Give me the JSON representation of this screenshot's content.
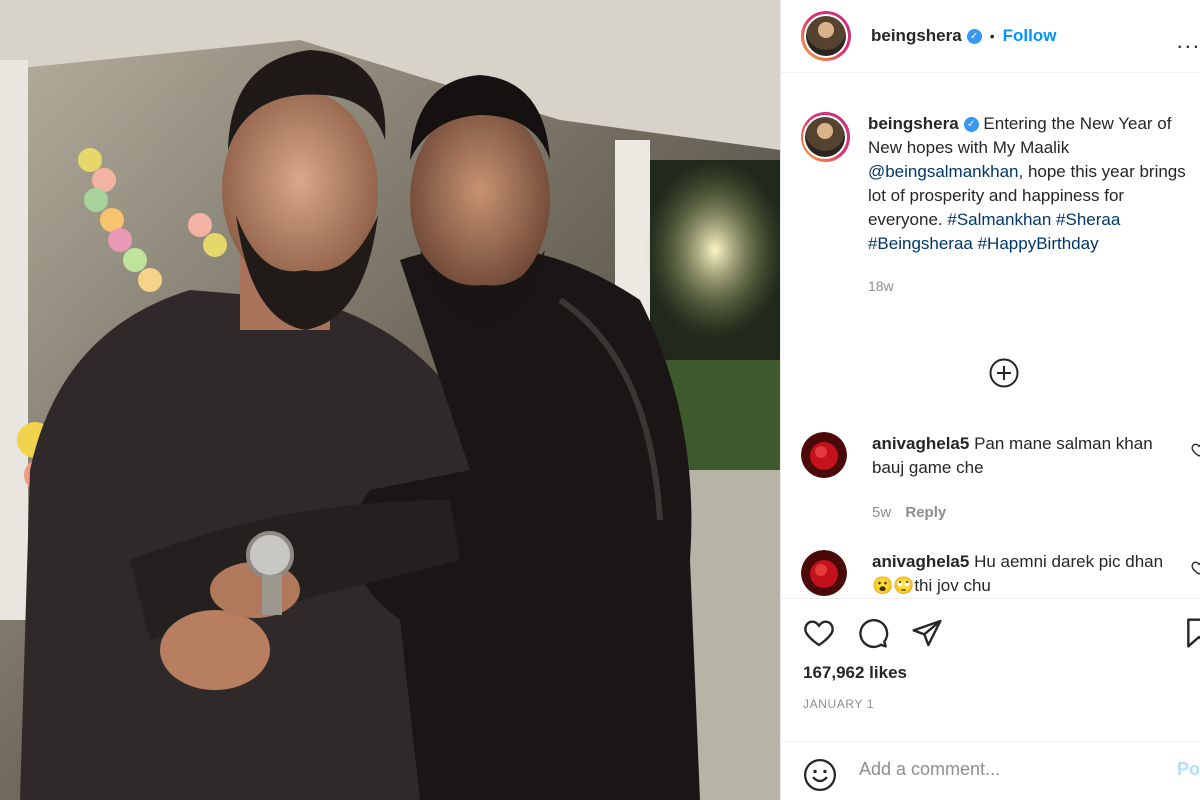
{
  "post": {
    "username": "beingshera",
    "follow_label": "Follow",
    "separator": "•",
    "more": "..."
  },
  "caption": {
    "username": "beingshera",
    "text_before": "Entering the New Year of New hopes with My Maalik ",
    "mention": "@beingsalmankhan",
    "text_after": ", hope this year brings lot of prosperity and happiness for everyone. ",
    "hashtags": "#Salmankhan #Sheraa #Beingsheraa #HappyBirthday",
    "time": "18w"
  },
  "comments": [
    {
      "username": "anivaghela5",
      "text": "Pan mane salman khan bauj game che",
      "time": "5w",
      "reply_label": "Reply"
    },
    {
      "username": "anivaghela5",
      "text": "Hu aemni darek pic dhan😮🙄thi jov chu"
    }
  ],
  "stats": {
    "likes": "167,962 likes",
    "date": "JANUARY 1"
  },
  "add_comment": {
    "placeholder": "Add a comment...",
    "post_label": "Post"
  },
  "colors": {
    "accent": "#0095f6",
    "link": "#00376b",
    "muted": "#8e8e8e",
    "verified": "#3897f0"
  },
  "icons": [
    "verified-badge-icon",
    "more-options-icon",
    "load-more-comments-icon",
    "heart-icon",
    "comment-icon",
    "share-icon",
    "bookmark-icon",
    "emoji-icon"
  ]
}
